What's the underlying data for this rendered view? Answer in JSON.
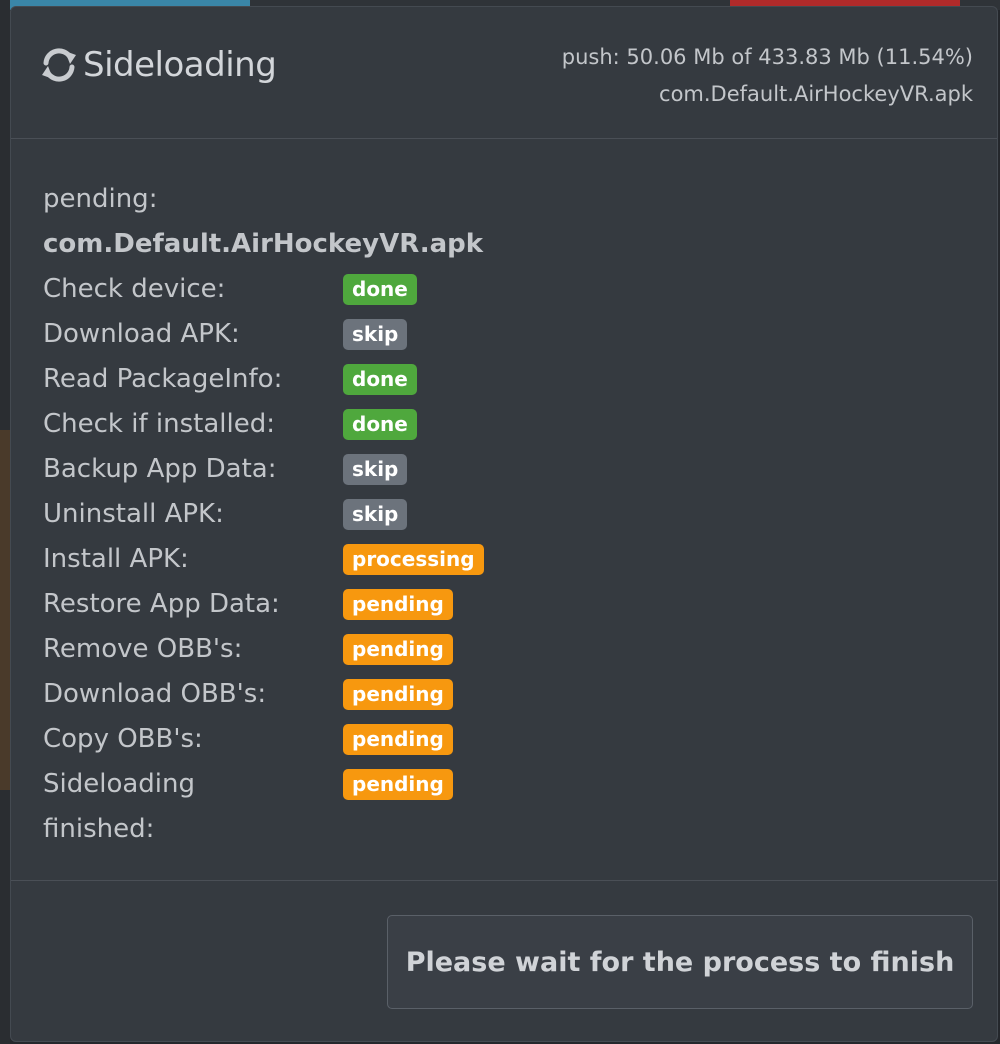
{
  "modal": {
    "title": "Sideloading",
    "title_icon": "sync-icon",
    "push_status": "push: 50.06 Mb of 433.83 Mb (11.54%)",
    "push_file": "com.Default.AirHockeyVR.apk"
  },
  "body": {
    "pending_label": "pending:",
    "pending_file": "com.Default.AirHockeyVR.apk",
    "steps": [
      {
        "label": "Check device:",
        "status": "done"
      },
      {
        "label": "Download APK:",
        "status": "skip"
      },
      {
        "label": "Read PackageInfo:",
        "status": "done"
      },
      {
        "label": "Check if installed:",
        "status": "done"
      },
      {
        "label": "Backup App Data:",
        "status": "skip"
      },
      {
        "label": "Uninstall APK:",
        "status": "skip"
      },
      {
        "label": "Install APK:",
        "status": "processing"
      },
      {
        "label": "Restore App Data:",
        "status": "pending"
      },
      {
        "label": "Remove OBB's:",
        "status": "pending"
      },
      {
        "label": "Download OBB's:",
        "status": "pending"
      },
      {
        "label": "Copy OBB's:",
        "status": "pending"
      },
      {
        "label": "Sideloading finished:",
        "status": "pending"
      }
    ]
  },
  "footer": {
    "wait_button_label": "Please wait for the process to finish"
  },
  "colors": {
    "done": "#4fa83d",
    "skip": "#6c737c",
    "processing": "#f7980f",
    "pending": "#f7980f",
    "modal_bg": "#353a40"
  }
}
